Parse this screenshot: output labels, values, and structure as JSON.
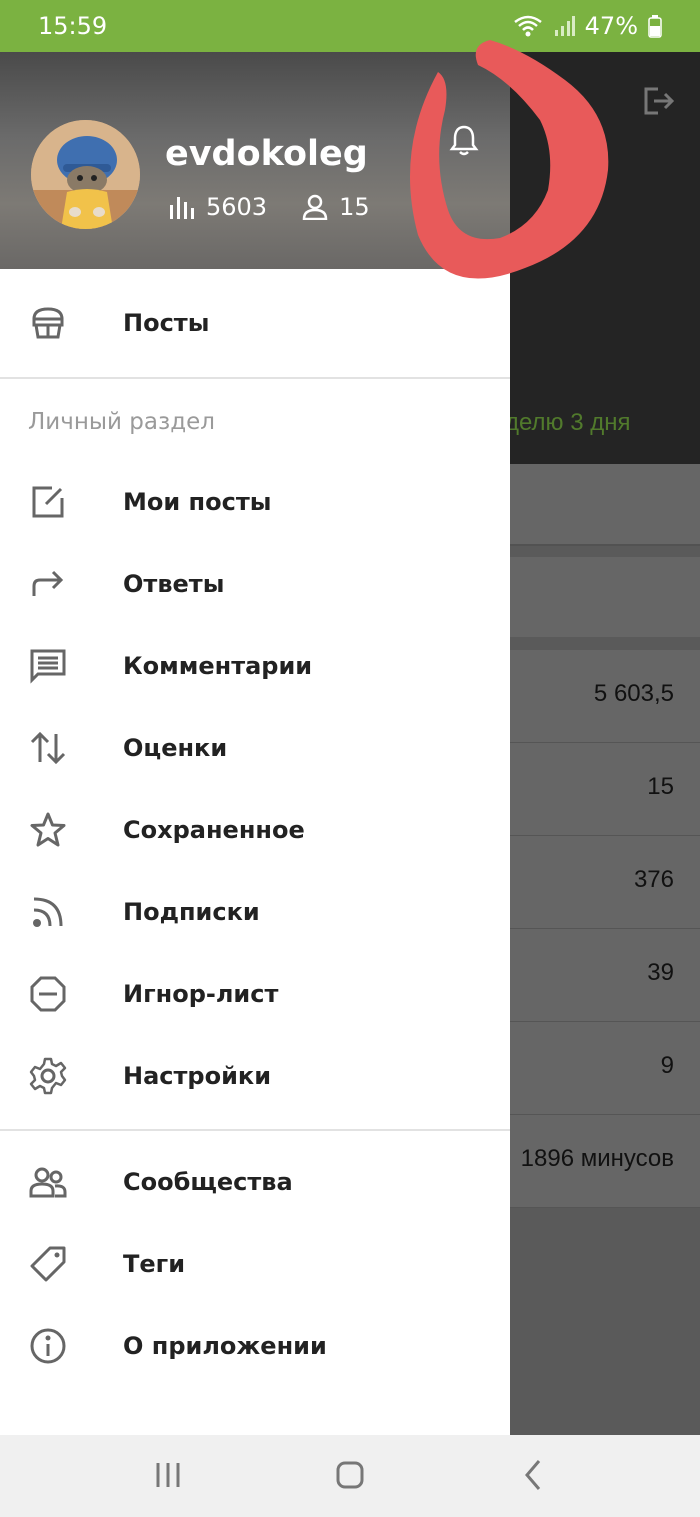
{
  "status_bar": {
    "time": "15:59",
    "battery": "47%"
  },
  "background": {
    "days_text": "делю 3 дня",
    "rows": [
      "5 603,5",
      "15",
      "376",
      "39",
      "9",
      "1896 минусов"
    ]
  },
  "profile": {
    "username": "evdokoleg",
    "rating": "5603",
    "subscribers": "15"
  },
  "menu": {
    "posts": "Посты",
    "section_title": "Личный раздел",
    "personal": [
      {
        "label": "Мои посты",
        "icon": "edit-icon"
      },
      {
        "label": "Ответы",
        "icon": "reply-arrow-icon"
      },
      {
        "label": "Комментарии",
        "icon": "comment-icon"
      },
      {
        "label": "Оценки",
        "icon": "up-down-arrows-icon"
      },
      {
        "label": "Сохраненное",
        "icon": "star-icon"
      },
      {
        "label": "Подписки",
        "icon": "rss-icon"
      },
      {
        "label": "Игнор-лист",
        "icon": "block-icon"
      },
      {
        "label": "Настройки",
        "icon": "gear-icon"
      }
    ],
    "other": [
      {
        "label": "Сообщества",
        "icon": "people-icon"
      },
      {
        "label": "Теги",
        "icon": "tag-icon"
      },
      {
        "label": "О приложении",
        "icon": "info-icon"
      }
    ]
  },
  "colors": {
    "status_bar": "#7bb241",
    "annotation": "#e85a5a"
  }
}
